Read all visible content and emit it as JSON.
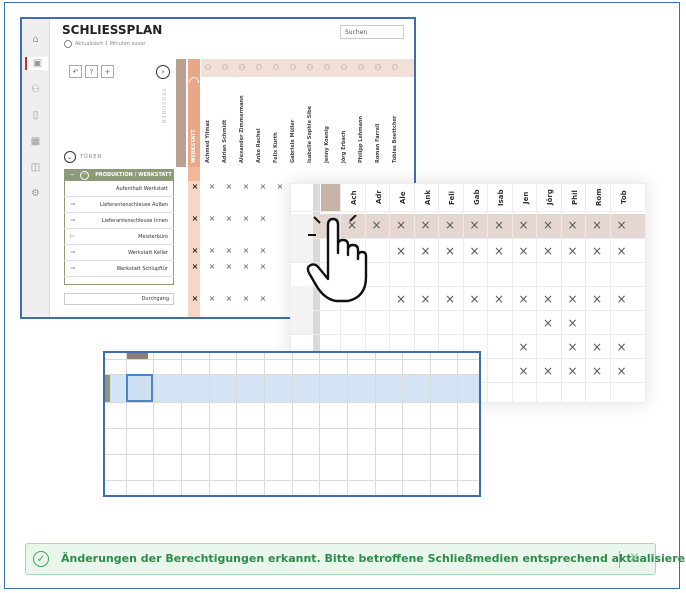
{
  "app": {
    "title": "SCHLIESSPLAN",
    "updated": "Aktualisiert 1 Minuten zuvor",
    "search_placeholder": "Suchen"
  },
  "toolbar": {
    "tool_undo": "↶",
    "tool_help": "?",
    "tool_add": "+"
  },
  "side_labels": {
    "personen": "PERSONEN",
    "tueren": "TÜREN"
  },
  "columns": {
    "werkstatt": "WERKSTATT",
    "persons": [
      "Achmed Yilmaz",
      "Adrian Schmidt",
      "Alexander Zimmermann",
      "Anke Rachel",
      "Felix Kurth",
      "Gabriele Müller",
      "Isabelle Sophie Sibe",
      "Jenny Koenig",
      "Jörg Erbach",
      "Philipp Lehmann",
      "Roman Farrell",
      "Tobias Boettcher"
    ]
  },
  "group": {
    "label": "PRODUKTION / WERKSTATT",
    "doors": [
      "Aufenthalt Werkstatt",
      "Lieferantenschleuse Außen",
      "Lieferantenschleuse Innen",
      "Meisterbüro",
      "Werkstatt Keller",
      "Werkstatt Schlupftür"
    ],
    "extra_door": "Durchgang"
  },
  "zoom_headers": [
    "Ach",
    "Adr",
    "Ale",
    "Ank",
    "Feli",
    "Gab",
    "Isab",
    "Jen",
    "Jörg",
    "Phil",
    "Rom",
    "Tob"
  ],
  "toast": {
    "message": "Änderungen der Berechtigungen erkannt. Bitte betroffene Schließmedien entsprechend aktualisieren.",
    "close_icon": "×"
  },
  "colors": {
    "accent_blue": "#3f6cb5",
    "orange": "#e8a888",
    "group_green": "#8c9a7a",
    "success": "#3aa55a"
  }
}
